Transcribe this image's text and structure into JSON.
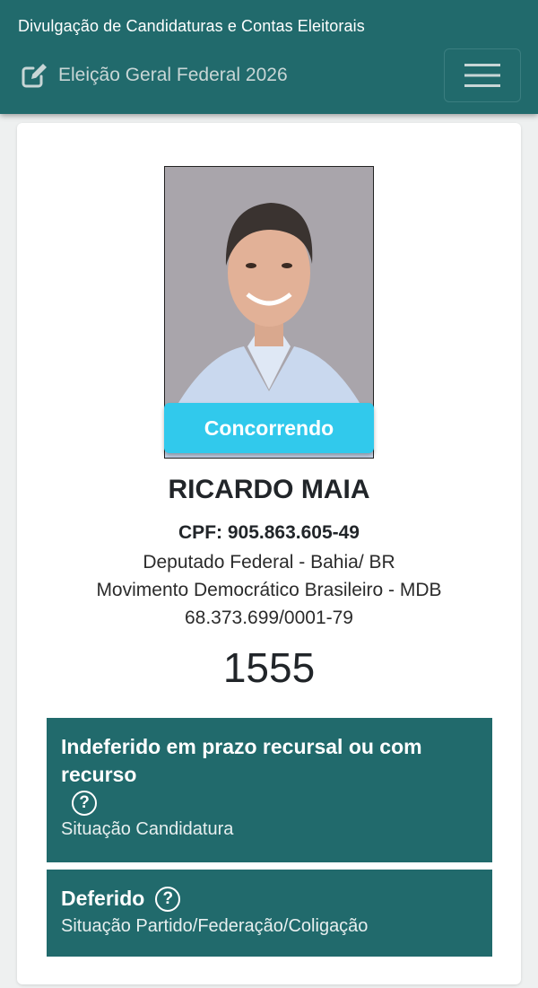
{
  "header": {
    "site_title": "Divulgação de Candidaturas e Contas Eleitorais",
    "election_label": "Eleição Geral Federal 2026",
    "icons": {
      "edit": "edit-icon",
      "menu": "hamburger-menu-icon"
    }
  },
  "candidate": {
    "status_badge": "Concorrendo",
    "name": "RICARDO MAIA",
    "cpf": "CPF: 905.863.605-49",
    "office": "Deputado Federal - Bahia/ BR",
    "party": "Movimento Democrático Brasileiro - MDB",
    "cnpj": "68.373.699/0001-79",
    "number": "1555"
  },
  "status_boxes": [
    {
      "title": "Indeferido em prazo recursal ou com recurso",
      "help": "?",
      "subtitle": "Situação Candidatura"
    },
    {
      "title": "Deferido",
      "help": "?",
      "subtitle": "Situação Partido/Federação/Coligação"
    }
  ],
  "colors": {
    "header": "#216a6c",
    "badge": "#31c9ec",
    "status_box": "#216a6c"
  }
}
